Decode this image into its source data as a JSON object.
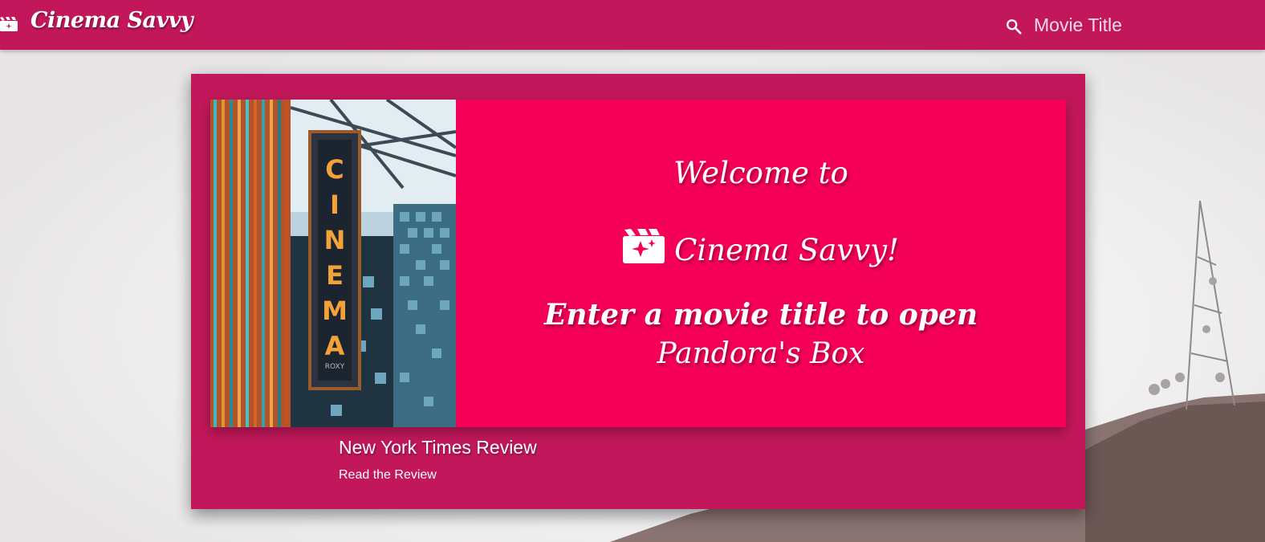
{
  "app": {
    "brand": "Cinema Savvy"
  },
  "search": {
    "placeholder": "Movie Title",
    "value": ""
  },
  "hero": {
    "welcome_line_1": "Welcome to",
    "welcome_line_2": "Cinema Savvy!",
    "welcome_line_3a": "Enter a movie title to open",
    "welcome_line_3b": "Pandora's Box",
    "sign_letters": [
      "C",
      "I",
      "N",
      "E",
      "M",
      "A"
    ],
    "sign_footer": "ROXY"
  },
  "review": {
    "title": "New York Times Review",
    "link_label": "Read the Review"
  },
  "colors": {
    "navbar": "#c2185b",
    "card": "#c2185b",
    "hero": "#f50057",
    "text": "#ffffff"
  },
  "icons": [
    "movie-clapper-icon",
    "search-icon",
    "movie-filter-icon"
  ]
}
